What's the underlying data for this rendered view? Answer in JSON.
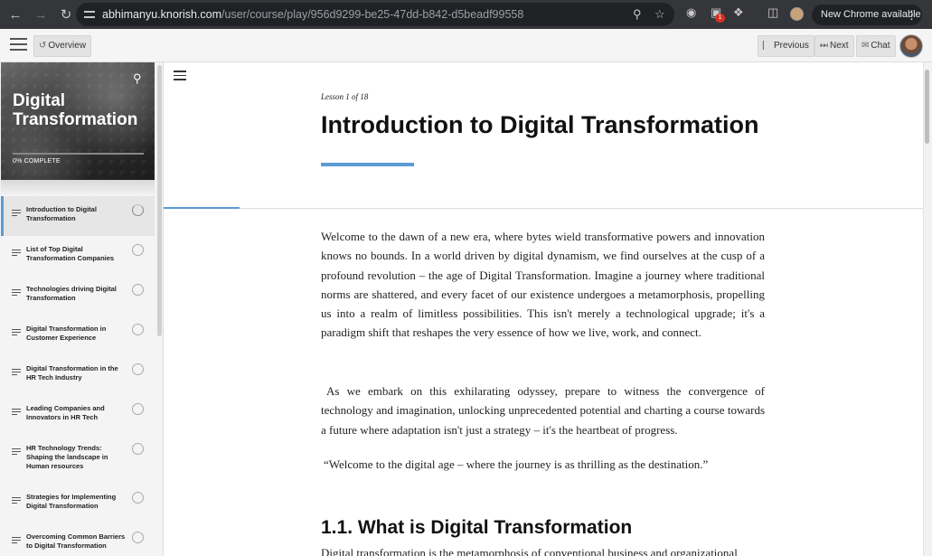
{
  "browser": {
    "url_host": "abhimanyu.knorish.com",
    "url_path": "/user/course/play/956d9299-be25-47dd-b842-d5beadf99558",
    "extension_badge": "1",
    "update_label": "New Chrome available"
  },
  "toolbar": {
    "overview_label": "Overview",
    "previous_label": "Previous",
    "next_label": "Next",
    "chat_label": "Chat"
  },
  "sidebar": {
    "course_title": "Digital Transformation",
    "progress_label": "0% COMPLETE",
    "progress_fraction": 0,
    "lessons": [
      {
        "label": "Introduction to Digital Transformation",
        "active": true
      },
      {
        "label": "List of Top Digital Transformation Companies"
      },
      {
        "label": "Technologies driving Digital Transformation"
      },
      {
        "label": "Digital Transformation in Customer Experience"
      },
      {
        "label": "Digital Transformation in the HR Tech Industry"
      },
      {
        "label": "Leading Companies and Innovators in HR Tech"
      },
      {
        "label": "HR Technology Trends: Shaping the landscape in Human resources"
      },
      {
        "label": "Strategies for Implementing Digital Transformation"
      },
      {
        "label": "Overcoming Common Barriers to Digital Transformation"
      }
    ]
  },
  "content": {
    "lesson_counter": "Lesson 1 of 18",
    "title": "Introduction to Digital Transformation",
    "paragraph1": "Welcome to the dawn of a new era, where bytes wield transformative powers and innovation knows no bounds. In a world driven by digital dynamism, we find ourselves at the cusp of a profound revolution – the age of Digital Transformation. Imagine a journey where traditional norms are shattered, and every facet of our existence undergoes a metamorphosis, propelling us into a realm of limitless possibilities. This isn't merely a technological upgrade; it's a paradigm shift that reshapes the very essence of how we live, work, and connect.",
    "paragraph2": "As we embark on this exhilarating odyssey, prepare to witness the convergence of technology and imagination, unlocking unprecedented potential and charting a course towards a future where adaptation isn't just a strategy – it's the heartbeat of progress.",
    "quote": "“Welcome to the digital age – where the journey is as thrilling as the destination.”",
    "section_heading": "1.1. What is Digital Transformation",
    "section_text": "Digital transformation is the metamorphosis of conventional business and organizational"
  }
}
